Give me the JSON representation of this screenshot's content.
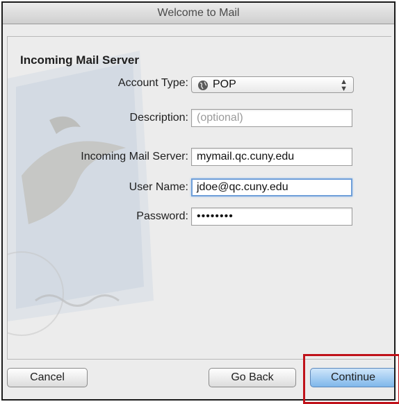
{
  "window": {
    "title": "Welcome to Mail"
  },
  "form": {
    "section_title": "Incoming Mail Server",
    "account_type": {
      "label": "Account Type:",
      "value": "POP",
      "icon": "globe-icon"
    },
    "description": {
      "label": "Description:",
      "value": "",
      "placeholder": "(optional)"
    },
    "incoming_server": {
      "label": "Incoming Mail Server:",
      "value": "mymail.qc.cuny.edu"
    },
    "user_name": {
      "label": "User Name:",
      "value": "jdoe@qc.cuny.edu"
    },
    "password": {
      "label": "Password:",
      "value": "••••••••"
    }
  },
  "buttons": {
    "cancel": "Cancel",
    "go_back": "Go Back",
    "continue": "Continue"
  },
  "colors": {
    "highlight": "#c0121a",
    "focus_ring": "#6f9fd9",
    "default_button": "#7fb7ea"
  }
}
